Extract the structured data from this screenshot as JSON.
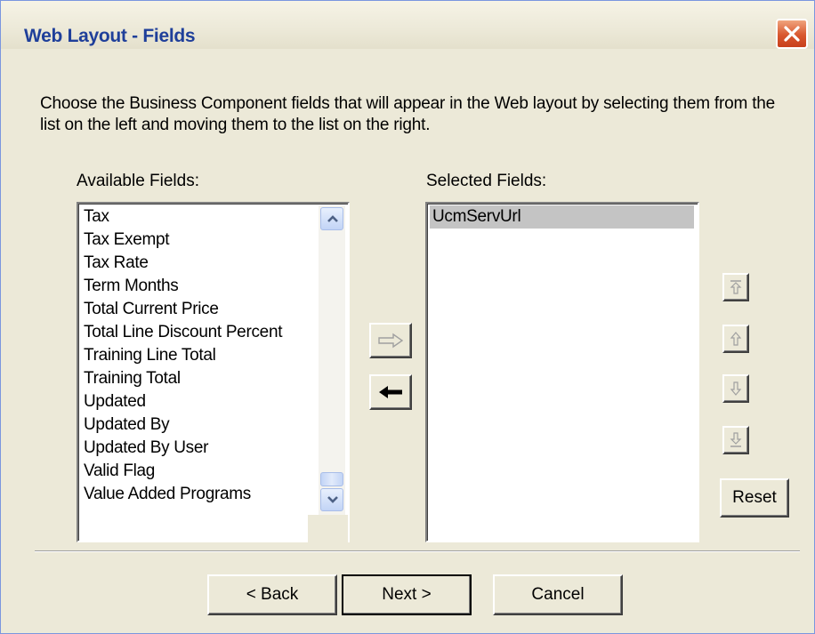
{
  "window": {
    "title": "Web Layout - Fields"
  },
  "instructions": "Choose the Business Component fields that will appear in the Web layout by selecting them from the list on the left and moving them to the list on the right.",
  "available": {
    "label": "Available Fields:",
    "items": [
      "Tax",
      "Tax Exempt",
      "Tax Rate",
      "Term Months",
      "Total Current Price",
      "Total Line Discount Percent",
      "Training Line Total",
      "Training Total",
      "Updated",
      "Updated By",
      "Updated By User",
      "Valid Flag",
      "Value Added Programs"
    ]
  },
  "selected": {
    "label": "Selected Fields:",
    "items": [
      "UcmServUrl"
    ]
  },
  "buttons": {
    "reset": "Reset",
    "back": "< Back",
    "next": "Next >",
    "cancel": "Cancel"
  },
  "icons": {
    "close": "close-icon",
    "move_right": "arrow-right-icon",
    "move_left": "arrow-left-icon",
    "move_top": "move-to-top-icon",
    "move_up": "move-up-icon",
    "move_down": "move-down-icon",
    "move_bottom": "move-to-bottom-icon"
  },
  "colors": {
    "title": "#1f3f9a",
    "close": "#d8572f",
    "dialog": "#ece9d8",
    "selection": "#c4c4c4"
  }
}
